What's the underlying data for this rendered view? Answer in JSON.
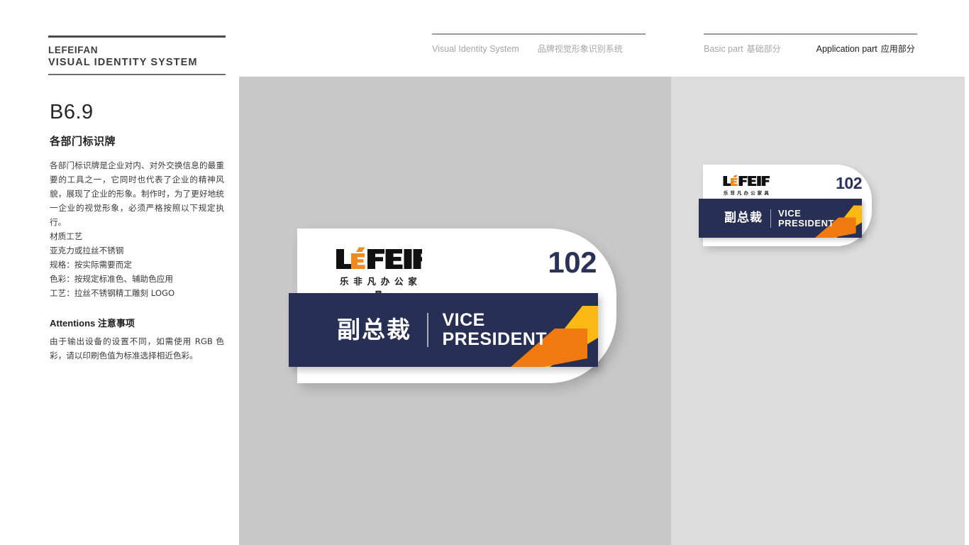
{
  "brand": {
    "name": "LEFEIFAN",
    "subtitle": "VISUAL IDENTITY SYSTEM"
  },
  "header": {
    "left_group": {
      "en": "Visual Identity System",
      "cn": "品牌视觉形象识别系统"
    },
    "right_group": {
      "basic_en": "Basic part",
      "basic_cn": "基础部分",
      "application_en": "Application part",
      "application_cn": "应用部分",
      "active": "Application part 应用部分"
    }
  },
  "sidebar": {
    "section_code": "B6.9",
    "section_title": "各部门标识牌",
    "description": "各部门标识牌是企业对内、对外交换信息的最重要的工具之一，它同时也代表了企业的精神风貌，展现了企业的形象。制作时，为了更好地统一企业的视觉形象，必须严格按照以下规定执行。",
    "spec_lines": [
      "材质工艺",
      "亚克力或拉丝不锈钢",
      "规格：按实际需要而定",
      "色彩：按规定标准色、辅助色应用",
      "工艺：拉丝不锈钢精工雕刻 LOGO"
    ],
    "attentions_en": "Attentions",
    "attentions_cn": "注意事项",
    "attentions_body": "由于输出设备的设置不同，如需使用 RGB 色彩，请以印刷色值为标准选择相近色彩。"
  },
  "sign": {
    "logo_en_prefix": "L",
    "logo_en_e": "E",
    "logo_en_suffix": "FEIFAN",
    "logo_cn": "乐 非 凡 办 公 家 具",
    "room_number": "102",
    "title_cn": "副总裁",
    "title_en_line1": "VICE",
    "title_en_line2": "PRESIDENT"
  },
  "colors": {
    "navy": "#272f54",
    "navy_text": "#2a3357",
    "gold": "#fbba13",
    "orange": "#f07a10",
    "logo_orange": "#f08a1e",
    "logo_black": "#111111",
    "stage_left": "#c8c8c8",
    "stage_right": "#dcdcdc"
  }
}
